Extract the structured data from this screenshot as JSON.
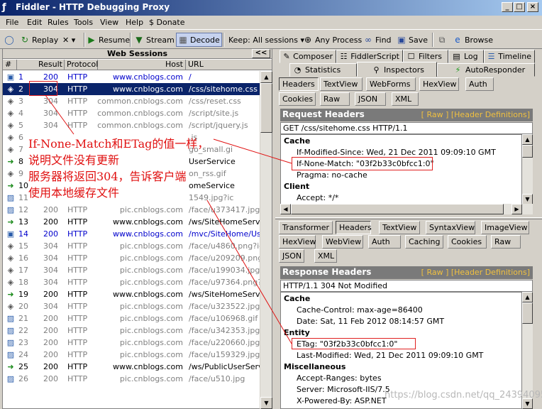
{
  "window": {
    "title": "Fiddler - HTTP Debugging Proxy"
  },
  "menu": [
    "File",
    "Edit",
    "Rules",
    "Tools",
    "View",
    "Help",
    "$ Donate"
  ],
  "toolbar": {
    "replay": "Replay",
    "remove": "✕ ▾",
    "resume": "Resume",
    "stream": "Stream",
    "decode": "Decode",
    "keep": "Keep: All sessions ▾",
    "any_process": "Any Process",
    "find": "Find",
    "save": "Save",
    "browse": "Browse"
  },
  "web_sessions": {
    "header": "Web Sessions",
    "collapse": "<<",
    "columns": [
      "#",
      "Result",
      "Protocol",
      "Host",
      "URL"
    ],
    "rows": [
      {
        "num": "1",
        "result": "200",
        "protocol": "HTTP",
        "host": "www.cnblogs.com",
        "url": "/",
        "style": "blue",
        "icon": "page-icon"
      },
      {
        "num": "2",
        "result": "304",
        "protocol": "HTTP",
        "host": "www.cnblogs.com",
        "url": "/css/sitehome.css",
        "style": "sel",
        "icon": "diamond-icon"
      },
      {
        "num": "3",
        "result": "304",
        "protocol": "HTTP",
        "host": "common.cnblogs.com",
        "url": "/css/reset.css",
        "style": "gray",
        "icon": "diamond-icon"
      },
      {
        "num": "4",
        "result": "304",
        "protocol": "HTTP",
        "host": "common.cnblogs.com",
        "url": "/script/site.js",
        "style": "gray",
        "icon": "diamond-icon"
      },
      {
        "num": "5",
        "result": "304",
        "protocol": "HTTP",
        "host": "common.cnblogs.com",
        "url": "/script/jquery.js",
        "style": "gray",
        "icon": "diamond-icon"
      },
      {
        "num": "6",
        "result": "",
        "protocol": "",
        "host": "",
        "url": ".js",
        "style": "gray",
        "icon": "diamond-icon"
      },
      {
        "num": "7",
        "result": "",
        "protocol": "",
        "host": "",
        "url": "go_small.gi",
        "style": "gray",
        "icon": "diamond-icon"
      },
      {
        "num": "8",
        "result": "",
        "protocol": "",
        "host": "",
        "url": "UserService",
        "style": "plain",
        "icon": "arrow-icon"
      },
      {
        "num": "9",
        "result": "",
        "protocol": "",
        "host": "",
        "url": "on_rss.gif",
        "style": "gray",
        "icon": "diamond-icon"
      },
      {
        "num": "10",
        "result": "",
        "protocol": "",
        "host": "",
        "url": "omeService",
        "style": "plain",
        "icon": "arrow-icon"
      },
      {
        "num": "11",
        "result": "",
        "protocol": "",
        "host": "",
        "url": "1549.jpg?ic",
        "style": "gray",
        "icon": "image-icon"
      },
      {
        "num": "12",
        "result": "200",
        "protocol": "HTTP",
        "host": "pic.cnblogs.com",
        "url": "/face/u373417.jpg?ic",
        "style": "gray",
        "icon": "image-icon"
      },
      {
        "num": "13",
        "result": "200",
        "protocol": "HTTP",
        "host": "www.cnblogs.com",
        "url": "/ws/SiteHomeService",
        "style": "plain",
        "icon": "arrow-icon"
      },
      {
        "num": "14",
        "result": "200",
        "protocol": "HTTP",
        "host": "www.cnblogs.com",
        "url": "/mvc/SiteHome/UserS",
        "style": "blue",
        "icon": "page-icon"
      },
      {
        "num": "15",
        "result": "304",
        "protocol": "HTTP",
        "host": "pic.cnblogs.com",
        "url": "/face/u4860.png?id=",
        "style": "gray",
        "icon": "diamond-icon"
      },
      {
        "num": "16",
        "result": "304",
        "protocol": "HTTP",
        "host": "pic.cnblogs.com",
        "url": "/face/u209209.png?i",
        "style": "gray",
        "icon": "diamond-icon"
      },
      {
        "num": "17",
        "result": "304",
        "protocol": "HTTP",
        "host": "pic.cnblogs.com",
        "url": "/face/u199034.jpg?i",
        "style": "gray",
        "icon": "diamond-icon"
      },
      {
        "num": "18",
        "result": "304",
        "protocol": "HTTP",
        "host": "pic.cnblogs.com",
        "url": "/face/u97364.png?id",
        "style": "gray",
        "icon": "diamond-icon"
      },
      {
        "num": "19",
        "result": "200",
        "protocol": "HTTP",
        "host": "www.cnblogs.com",
        "url": "/ws/SiteHomeService",
        "style": "plain",
        "icon": "arrow-icon"
      },
      {
        "num": "20",
        "result": "304",
        "protocol": "HTTP",
        "host": "pic.cnblogs.com",
        "url": "/face/u323522.jpg?i",
        "style": "gray",
        "icon": "diamond-icon"
      },
      {
        "num": "21",
        "result": "200",
        "protocol": "HTTP",
        "host": "pic.cnblogs.com",
        "url": "/face/u106968.gif",
        "style": "gray",
        "icon": "image-icon"
      },
      {
        "num": "22",
        "result": "200",
        "protocol": "HTTP",
        "host": "pic.cnblogs.com",
        "url": "/face/u342353.jpg?ic",
        "style": "gray",
        "icon": "image-icon"
      },
      {
        "num": "23",
        "result": "200",
        "protocol": "HTTP",
        "host": "pic.cnblogs.com",
        "url": "/face/u220660.jpg?ic",
        "style": "gray",
        "icon": "image-icon"
      },
      {
        "num": "24",
        "result": "200",
        "protocol": "HTTP",
        "host": "pic.cnblogs.com",
        "url": "/face/u159329.jpg",
        "style": "gray",
        "icon": "image-icon"
      },
      {
        "num": "25",
        "result": "200",
        "protocol": "HTTP",
        "host": "www.cnblogs.com",
        "url": "/ws/PublicUserService",
        "style": "plain",
        "icon": "arrow-icon"
      },
      {
        "num": "26",
        "result": "200",
        "protocol": "HTTP",
        "host": "pic.cnblogs.com",
        "url": "/face/u510.jpg",
        "style": "gray",
        "icon": "image-icon"
      }
    ]
  },
  "annotation": {
    "line1": "If-None-Match和ETag的值一样，",
    "line2": "说明文件没有更新",
    "line3": "服务器将返回304，告诉客户端",
    "line4": "使用本地缓存文件"
  },
  "tabs_row1": [
    "Composer",
    "FiddlerScript",
    "Filters",
    "Log",
    "Timeline"
  ],
  "tabs_row2": [
    "Statistics",
    "Inspectors",
    "AutoResponder"
  ],
  "request": {
    "subtabs1": [
      "Headers",
      "TextView",
      "WebForms",
      "HexView",
      "Auth"
    ],
    "subtabs2": [
      "Cookies",
      "Raw",
      "JSON",
      "XML"
    ],
    "panel_title": "Request Headers",
    "links": "[ Raw ]   [Header Definitions]",
    "request_line": "GET /css/sitehome.css HTTP/1.1",
    "sec_cache": "Cache",
    "if_modified_since": "If-Modified-Since: Wed, 21 Dec 2011 09:09:10 GMT",
    "if_none_match": "If-None-Match: \"03f2b33c0bfcc1:0\"",
    "pragma": "Pragma: no-cache",
    "sec_client": "Client",
    "accept": "Accept: */*"
  },
  "response": {
    "subtabs1": [
      "Transformer",
      "Headers",
      "TextView",
      "SyntaxView",
      "ImageView"
    ],
    "subtabs2": [
      "HexView",
      "WebView",
      "Auth",
      "Caching",
      "Cookies",
      "Raw"
    ],
    "subtabs3": [
      "JSON",
      "XML"
    ],
    "panel_title": "Response Headers",
    "links": "[ Raw ]   [Header Definitions]",
    "status_line": "HTTP/1.1 304 Not Modified",
    "sec_cache": "Cache",
    "cache_control": "Cache-Control: max-age=86400",
    "date": "Date: Sat, 11 Feb 2012 08:14:57 GMT",
    "sec_entity": "Entity",
    "etag": "ETag: \"03f2b33c0bfcc1:0\"",
    "last_modified": "Last-Modified: Wed, 21 Dec 2011 09:09:10 GMT",
    "sec_misc": "Miscellaneous",
    "accept_ranges": "Accept-Ranges: bytes",
    "server": "Server: Microsoft-IIS/7.5",
    "powered_by": "X-Powered-By: ASP.NET"
  },
  "watermark": "https://blog.csdn.net/qq_24394095",
  "colors": {
    "selection": "#0a246a",
    "annotation": "#e01010",
    "header_bar": "#7a7a7a",
    "link_yellow": "#f0c040"
  }
}
